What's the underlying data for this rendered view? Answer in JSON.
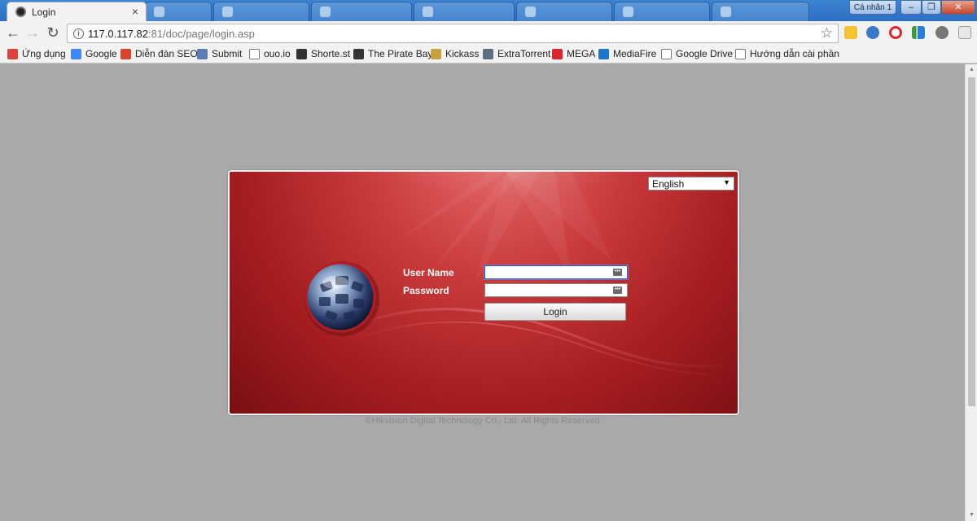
{
  "browser": {
    "active_tab": {
      "title": "Login",
      "close_label": "×"
    },
    "window_user_label": "Cá nhân 1",
    "window_buttons": {
      "minimize": "–",
      "restore": "❐",
      "close": "✕"
    },
    "url": {
      "host": "117.0.117.82",
      "rest": ":81/doc/page/login.asp"
    },
    "bookmarks": [
      {
        "label": "Ứng dụng",
        "icon": "apps-grid-icon",
        "color": "#e0433b"
      },
      {
        "label": "Google",
        "icon": "google-icon",
        "color": "#4285f4"
      },
      {
        "label": "Diễn đàn SEO",
        "icon": "idvs-icon",
        "color": "#d9452c"
      },
      {
        "label": "Submit",
        "icon": "submit-icon",
        "color": "#5a7db5"
      },
      {
        "label": "ouo.io",
        "icon": "page-icon",
        "color": "#ffffff"
      },
      {
        "label": "Shorte.st",
        "icon": "shortest-icon",
        "color": "#333333"
      },
      {
        "label": "The Pirate Bay",
        "icon": "pirate-ship-icon",
        "color": "#333333"
      },
      {
        "label": "Kickass",
        "icon": "kickass-icon",
        "color": "#c8a13a"
      },
      {
        "label": "ExtraTorrent",
        "icon": "extratorrent-icon",
        "color": "#5c6f82"
      },
      {
        "label": "MEGA",
        "icon": "mega-icon",
        "color": "#d9272e"
      },
      {
        "label": "MediaFire",
        "icon": "mediafire-icon",
        "color": "#1f75cb"
      },
      {
        "label": "Google Drive",
        "icon": "page-icon",
        "color": "#ffffff"
      },
      {
        "label": "Hướng dẫn cài phần",
        "icon": "page-icon",
        "color": "#ffffff"
      }
    ]
  },
  "login": {
    "language": "English",
    "username_label": "User Name",
    "password_label": "Password",
    "username_value": "",
    "password_value": "",
    "login_button": "Login",
    "copyright": "©Hikvision Digital Technology Co., Ltd. All Rights Reserved."
  }
}
